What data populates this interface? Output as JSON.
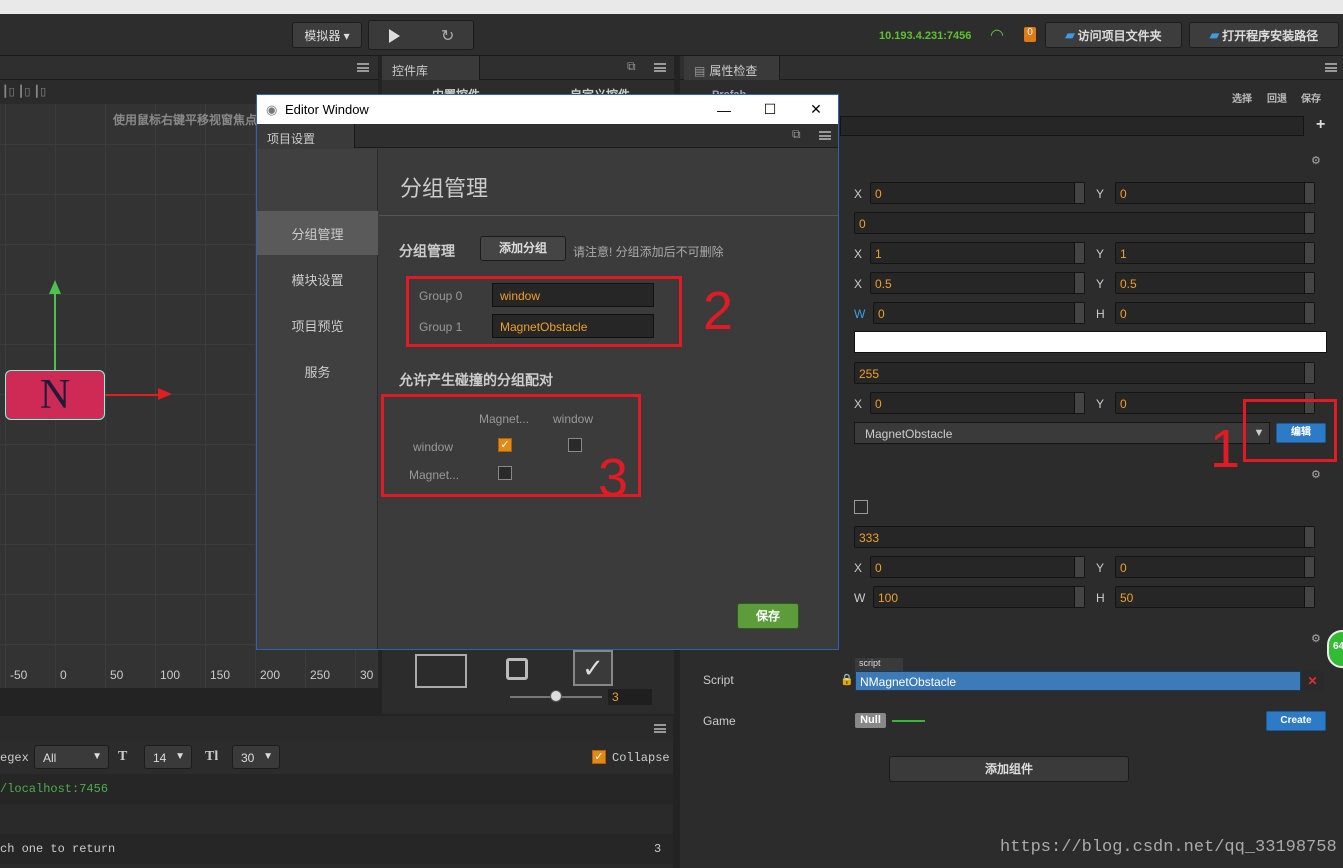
{
  "toolbar": {
    "simulator": "模拟器 ▾",
    "ip": "10.193.4.231:7456",
    "badge": "0",
    "open_project": "访问项目文件夹",
    "open_install": "打开程序安装路径"
  },
  "scene": {
    "hint": "使用鼠标右键平移视窗焦点",
    "ruler": [
      "-50",
      "0",
      "50",
      "100",
      "150",
      "200",
      "250",
      "30"
    ],
    "node_letter": "N"
  },
  "library": {
    "tab": "控件库",
    "builtin": "内置控件",
    "custom": "自定义控件",
    "slider_value": "3"
  },
  "inspector": {
    "tab": "属性检查器",
    "prefab_label": "Prefab",
    "actions": [
      "选择",
      "回退",
      "保存"
    ],
    "rows": {
      "pos_x": "0",
      "pos_y": "0",
      "rotation": "0",
      "scale_x": "1",
      "scale_y": "1",
      "anchor_x": "0.5",
      "anchor_y": "0.5",
      "size_w": "0",
      "size_h": "0",
      "opacity": "255",
      "skew_x": "0",
      "skew_y": "0",
      "group": "MagnetObstacle",
      "edit_btn": "编辑",
      "tag": "333",
      "off_x": "0",
      "off_y": "0",
      "box_w": "100",
      "box_h": "50"
    },
    "script_label": "Script",
    "script_tag": "script",
    "script_value": "NMagnetObstacle",
    "game_label": "Game",
    "null_label": "Null",
    "create_btn": "Create",
    "add_component": "添加组件",
    "green_badge": "64",
    "labels": {
      "x": "X",
      "y": "Y",
      "w": "W",
      "h": "H"
    }
  },
  "editor_window": {
    "title": "Editor Window",
    "tab": "项目设置",
    "sidebar": [
      "分组管理",
      "模块设置",
      "项目预览",
      "服务"
    ],
    "heading": "分组管理",
    "group_label": "分组管理",
    "add_group": "添加分组",
    "note": "请注意! 分组添加后不可删除",
    "groups": [
      {
        "label": "Group 0",
        "value": "window"
      },
      {
        "label": "Group 1",
        "value": "MagnetObstacle"
      }
    ],
    "collision_title": "允许产生碰撞的分组配对",
    "matrix_cols": [
      "Magnet...",
      "window"
    ],
    "matrix_rows": [
      "window",
      "Magnet..."
    ],
    "save": "保存"
  },
  "annotations": [
    "1",
    "2",
    "3"
  ],
  "console": {
    "regex": "egex",
    "filter": "All",
    "font_size": "14",
    "line_height": "30",
    "collapse": "Collapse",
    "lines": [
      "/localhost:7456",
      "ch one to return"
    ],
    "count": "3"
  },
  "watermark": "https://blog.csdn.net/qq_33198758"
}
